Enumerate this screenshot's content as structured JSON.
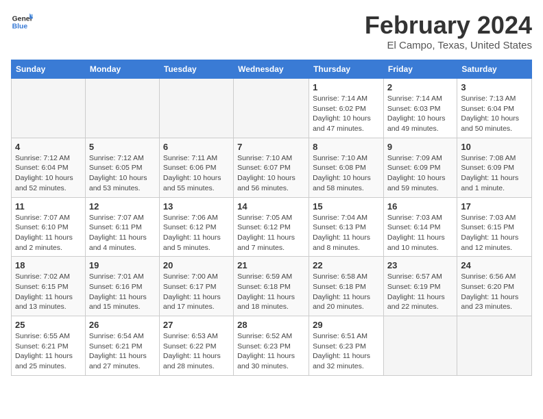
{
  "header": {
    "logo_line1": "General",
    "logo_line2": "Blue",
    "title": "February 2024",
    "subtitle": "El Campo, Texas, United States"
  },
  "calendar": {
    "days_of_week": [
      "Sunday",
      "Monday",
      "Tuesday",
      "Wednesday",
      "Thursday",
      "Friday",
      "Saturday"
    ],
    "weeks": [
      [
        {
          "day": "",
          "info": ""
        },
        {
          "day": "",
          "info": ""
        },
        {
          "day": "",
          "info": ""
        },
        {
          "day": "",
          "info": ""
        },
        {
          "day": "1",
          "info": "Sunrise: 7:14 AM\nSunset: 6:02 PM\nDaylight: 10 hours and 47 minutes."
        },
        {
          "day": "2",
          "info": "Sunrise: 7:14 AM\nSunset: 6:03 PM\nDaylight: 10 hours and 49 minutes."
        },
        {
          "day": "3",
          "info": "Sunrise: 7:13 AM\nSunset: 6:04 PM\nDaylight: 10 hours and 50 minutes."
        }
      ],
      [
        {
          "day": "4",
          "info": "Sunrise: 7:12 AM\nSunset: 6:04 PM\nDaylight: 10 hours and 52 minutes."
        },
        {
          "day": "5",
          "info": "Sunrise: 7:12 AM\nSunset: 6:05 PM\nDaylight: 10 hours and 53 minutes."
        },
        {
          "day": "6",
          "info": "Sunrise: 7:11 AM\nSunset: 6:06 PM\nDaylight: 10 hours and 55 minutes."
        },
        {
          "day": "7",
          "info": "Sunrise: 7:10 AM\nSunset: 6:07 PM\nDaylight: 10 hours and 56 minutes."
        },
        {
          "day": "8",
          "info": "Sunrise: 7:10 AM\nSunset: 6:08 PM\nDaylight: 10 hours and 58 minutes."
        },
        {
          "day": "9",
          "info": "Sunrise: 7:09 AM\nSunset: 6:09 PM\nDaylight: 10 hours and 59 minutes."
        },
        {
          "day": "10",
          "info": "Sunrise: 7:08 AM\nSunset: 6:09 PM\nDaylight: 11 hours and 1 minute."
        }
      ],
      [
        {
          "day": "11",
          "info": "Sunrise: 7:07 AM\nSunset: 6:10 PM\nDaylight: 11 hours and 2 minutes."
        },
        {
          "day": "12",
          "info": "Sunrise: 7:07 AM\nSunset: 6:11 PM\nDaylight: 11 hours and 4 minutes."
        },
        {
          "day": "13",
          "info": "Sunrise: 7:06 AM\nSunset: 6:12 PM\nDaylight: 11 hours and 5 minutes."
        },
        {
          "day": "14",
          "info": "Sunrise: 7:05 AM\nSunset: 6:12 PM\nDaylight: 11 hours and 7 minutes."
        },
        {
          "day": "15",
          "info": "Sunrise: 7:04 AM\nSunset: 6:13 PM\nDaylight: 11 hours and 8 minutes."
        },
        {
          "day": "16",
          "info": "Sunrise: 7:03 AM\nSunset: 6:14 PM\nDaylight: 11 hours and 10 minutes."
        },
        {
          "day": "17",
          "info": "Sunrise: 7:03 AM\nSunset: 6:15 PM\nDaylight: 11 hours and 12 minutes."
        }
      ],
      [
        {
          "day": "18",
          "info": "Sunrise: 7:02 AM\nSunset: 6:15 PM\nDaylight: 11 hours and 13 minutes."
        },
        {
          "day": "19",
          "info": "Sunrise: 7:01 AM\nSunset: 6:16 PM\nDaylight: 11 hours and 15 minutes."
        },
        {
          "day": "20",
          "info": "Sunrise: 7:00 AM\nSunset: 6:17 PM\nDaylight: 11 hours and 17 minutes."
        },
        {
          "day": "21",
          "info": "Sunrise: 6:59 AM\nSunset: 6:18 PM\nDaylight: 11 hours and 18 minutes."
        },
        {
          "day": "22",
          "info": "Sunrise: 6:58 AM\nSunset: 6:18 PM\nDaylight: 11 hours and 20 minutes."
        },
        {
          "day": "23",
          "info": "Sunrise: 6:57 AM\nSunset: 6:19 PM\nDaylight: 11 hours and 22 minutes."
        },
        {
          "day": "24",
          "info": "Sunrise: 6:56 AM\nSunset: 6:20 PM\nDaylight: 11 hours and 23 minutes."
        }
      ],
      [
        {
          "day": "25",
          "info": "Sunrise: 6:55 AM\nSunset: 6:21 PM\nDaylight: 11 hours and 25 minutes."
        },
        {
          "day": "26",
          "info": "Sunrise: 6:54 AM\nSunset: 6:21 PM\nDaylight: 11 hours and 27 minutes."
        },
        {
          "day": "27",
          "info": "Sunrise: 6:53 AM\nSunset: 6:22 PM\nDaylight: 11 hours and 28 minutes."
        },
        {
          "day": "28",
          "info": "Sunrise: 6:52 AM\nSunset: 6:23 PM\nDaylight: 11 hours and 30 minutes."
        },
        {
          "day": "29",
          "info": "Sunrise: 6:51 AM\nSunset: 6:23 PM\nDaylight: 11 hours and 32 minutes."
        },
        {
          "day": "",
          "info": ""
        },
        {
          "day": "",
          "info": ""
        }
      ]
    ]
  }
}
